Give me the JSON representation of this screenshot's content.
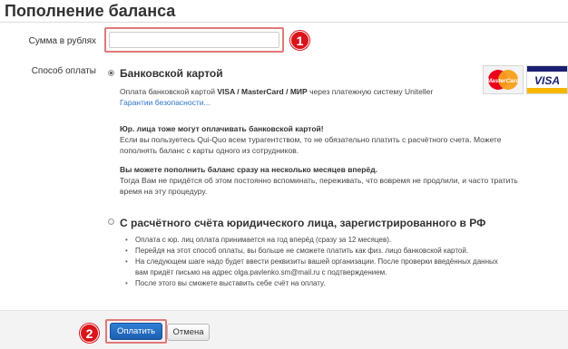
{
  "page": {
    "title": "Пополнение баланса"
  },
  "amount": {
    "label": "Сумма в рублях",
    "value": "",
    "placeholder": ""
  },
  "payment_method": {
    "label": "Способ оплаты",
    "card": {
      "title": "Банковской картой",
      "selected": true,
      "desc_prefix": "Оплата банковской картой ",
      "desc_cards": "VISA / MasterCard / МИР",
      "desc_suffix": " через платежную систему Uniteller",
      "guarantee_link": "Гарантии безопасности...",
      "note1_title": "Юр. лица тоже могут оплачивать банковской картой!",
      "note1_line1": "Если вы пользуетесь Qui-Quo всем турагентством, то не обязательно платить с расчётного счета. Можете",
      "note1_line2": "пополнять баланс с карты одного из сотрудников.",
      "note2_title": "Вы можете пополнить баланс сразу на несколько месяцев вперёд.",
      "note2_line1": "Тогда Вам не придётся об этом постоянно вспоминать, переживать, что вовремя не продлили, и часто тратить",
      "note2_line2": "время на эту процедуру.",
      "logos": [
        {
          "name": "mastercard-logo",
          "text": "MasterCard",
          "color": "#eb001b"
        },
        {
          "name": "visa-logo",
          "text": "VISA",
          "color": "#1a1f71"
        }
      ]
    },
    "invoice": {
      "title": "С расчётного счёта юридического лица, зарегистрированного в РФ",
      "selected": false,
      "bullets": [
        "Оплата с юр. лиц оплата принимается на год вперёд (сразу за 12 месяцев).",
        "Перейдя на этот способ оплаты, вы больше не сможете платить как физ. лицо банковской картой.",
        "На следующем шаге надо будет ввести реквизиты вашей организации. После проверки введённых данных",
        "вам придёт письмо на адрес olga.pavlenko.sm@mail.ru с подтверждением.",
        "После этого вы сможете выставить себе счёт на оплату."
      ]
    }
  },
  "buttons": {
    "pay": "Оплатить",
    "cancel": "Отмена"
  },
  "steps": {
    "one": "1",
    "two": "2"
  },
  "colors": {
    "accent": "#2a74c8",
    "primary_button": "#1d5fb0",
    "badge": "#d9141b",
    "highlight_frame": "#e07a7a"
  }
}
